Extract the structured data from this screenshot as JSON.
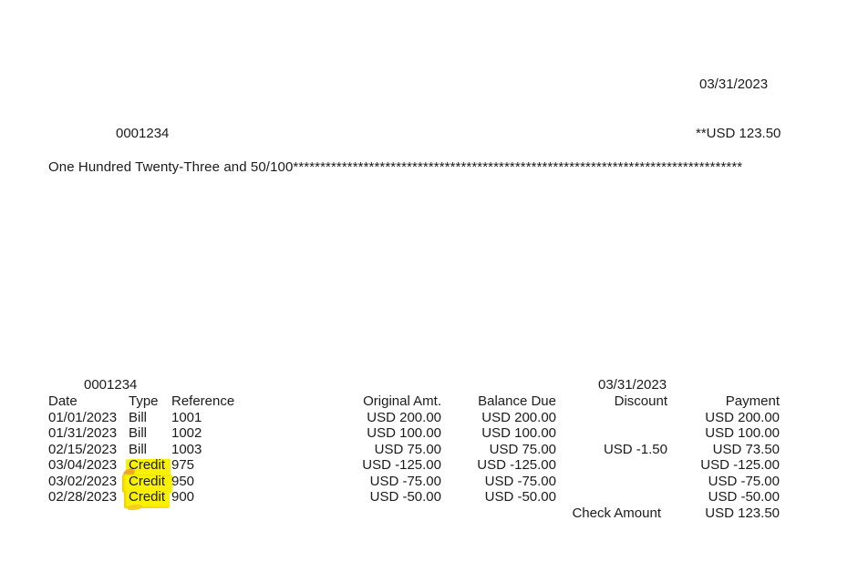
{
  "check": {
    "date": "03/31/2023",
    "check_number": "0001234",
    "amount_numeric": "**USD 123.50",
    "amount_words": "One Hundred Twenty-Three and 50/100***********************************************************************************"
  },
  "stub": {
    "check_number": "0001234",
    "date": "03/31/2023",
    "columns": [
      "Date",
      "Type",
      "Reference",
      "Original Amt.",
      "Balance Due",
      "Discount",
      "Payment"
    ],
    "rows": [
      {
        "date": "01/01/2023",
        "type": "Bill",
        "reference": "1001",
        "original_amt": "USD 200.00",
        "balance_due": "USD 200.00",
        "discount": "",
        "payment": "USD 200.00",
        "highlighted": false
      },
      {
        "date": "01/31/2023",
        "type": "Bill",
        "reference": "1002",
        "original_amt": "USD 100.00",
        "balance_due": "USD 100.00",
        "discount": "",
        "payment": "USD 100.00",
        "highlighted": false
      },
      {
        "date": "02/15/2023",
        "type": "Bill",
        "reference": "1003",
        "original_amt": "USD 75.00",
        "balance_due": "USD 75.00",
        "discount": "USD -1.50",
        "payment": "USD 73.50",
        "highlighted": false
      },
      {
        "date": "03/04/2023",
        "type": "Credit",
        "reference": "975",
        "original_amt": "USD -125.00",
        "balance_due": "USD -125.00",
        "discount": "",
        "payment": "USD -125.00",
        "highlighted": true
      },
      {
        "date": "03/02/2023",
        "type": "Credit",
        "reference": "950",
        "original_amt": "USD -75.00",
        "balance_due": "USD -75.00",
        "discount": "",
        "payment": "USD -75.00",
        "highlighted": true
      },
      {
        "date": "02/28/2023",
        "type": "Credit",
        "reference": "900",
        "original_amt": "USD -50.00",
        "balance_due": "USD -50.00",
        "discount": "",
        "payment": "USD -50.00",
        "highlighted": true
      }
    ],
    "total_label": "Check Amount",
    "total_value": "USD 123.50"
  },
  "annotation": {
    "highlight_color": "#f8f103",
    "highlight_edge_color": "#eca02c",
    "highlighted_text": "Credit"
  }
}
